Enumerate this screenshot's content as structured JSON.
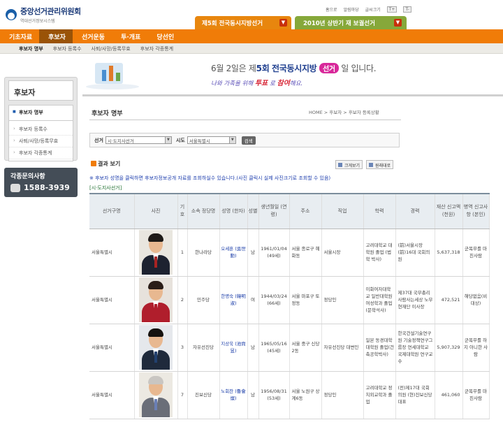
{
  "header": {
    "logo_title": "중앙선거관리위원회",
    "logo_subtitle": "역대선거정보시스템",
    "util_links": [
      "홈으로",
      "알림마당",
      "글씨크기"
    ],
    "font_up": "T+",
    "font_down": "T-"
  },
  "election_tabs": [
    {
      "label": "제5회 전국동시지방선거",
      "color": "#e8860e"
    },
    {
      "label": "2010년 상반기 재 보궐선거",
      "color": "#86a83a"
    }
  ],
  "nav": {
    "items": [
      "기초자료",
      "후보자",
      "선거운동",
      "투·개표",
      "당선인"
    ],
    "active": "후보자"
  },
  "subnav": {
    "items": [
      "후보자 명부",
      "후보자 등록수",
      "사퇴/사망/등록무효",
      "후보자 각종통계"
    ],
    "active": "후보자 명부"
  },
  "banner": {
    "line1_pre": "6월 2일은 제",
    "line1_num": "5회",
    "line1_mid": "전국동시지방",
    "line1_badge": "선거",
    "line1_post": "일 입니다.",
    "line2_pre": "나와 가족을 위해",
    "line2_red1": "투표",
    "line2_mid": "로",
    "line2_red2": "참여",
    "line2_post": "해요."
  },
  "sidebar": {
    "title": "후보자",
    "items": [
      "후보자 명부",
      "후보자 등록수",
      "사퇴/사망/등록무효",
      "후보자 각종통계"
    ],
    "active": "후보자 명부",
    "help_title": "각종문의사항",
    "help_phone": "1588-3939"
  },
  "page": {
    "title": "후보자 명부",
    "breadcrumb": "HOME > 후보자 > 후보자 등록상황"
  },
  "search": {
    "election_label": "선거",
    "election_value": "시·도지사선거",
    "sido_label": "시도",
    "sido_value": "서울특별시",
    "button": "검색"
  },
  "results": {
    "label": "결과 보기",
    "btn_photo": "크게보기",
    "btn_print": "원래대로",
    "note": "※ 후보자 성명을 클릭하면 후보자정보공개 자료를 조회하실수 있습니다.(사진 클릭시 실제 사진크기로 조회할 수 있음)",
    "subtitle": "[시·도지사선거]"
  },
  "table": {
    "headers": [
      "선거구명",
      "사진",
      "기호",
      "소속 정당명",
      "성명 (한자)",
      "성별",
      "생년월일 (연령)",
      "주소",
      "직업",
      "학력",
      "경력",
      "재산 신고액 (천원)",
      "병역 신고사항 (본인)"
    ],
    "rows": [
      {
        "district": "서울특별시",
        "photo": "candidate-photo-1",
        "number": "1",
        "party": "한나라당",
        "name": "오세훈 (吳世勳)",
        "gender": "남",
        "birth": "1961/01/04 (49세)",
        "address": "서울 종로구 혜화동",
        "job": "서울시장",
        "edu": "고려대학교 대학원 졸업 (법학 박사)",
        "career": "(前)서울시장 (前)16대 국회의원",
        "assets": "5,637,318",
        "military": "군복무를 마친사람"
      },
      {
        "district": "서울특별시",
        "photo": "candidate-photo-2",
        "number": "2",
        "party": "민주당",
        "name": "한명숙 (韓明淑)",
        "gender": "여",
        "birth": "1944/03/24 (66세)",
        "address": "서울 마포구 토정동",
        "job": "정당인",
        "edu": "이화여자대학교 일반대학원 여성학과 졸업(문학석사)",
        "career": "제37대 국무총리 사람사는세상 노무현재단 이사장",
        "assets": "472,521",
        "military": "해당없음(비대상)"
      },
      {
        "district": "서울특별시",
        "photo": "candidate-photo-3",
        "number": "3",
        "party": "자유선진당",
        "name": "지상욱 (池尙昱)",
        "gender": "남",
        "birth": "1965/05/16 (45세)",
        "address": "서울 중구 신당2동",
        "job": "자유선진당 대변인",
        "edu": "일본 동경대학대학원 졸업(건축공학박사)",
        "career": "한국건설기술연구원 기술정책연구그룹장 연세대학교 국제대학원 연구교수",
        "assets": "5,907,329",
        "military": "군복무를 하지 아니한 사람"
      },
      {
        "district": "서울특별시",
        "photo": "candidate-photo-4",
        "number": "7",
        "party": "진보신당",
        "name": "노회찬 (魯會燦)",
        "gender": "남",
        "birth": "1956/08/31 (53세)",
        "address": "서울 노원구 상계6동",
        "job": "정당인",
        "edu": "고려대학교 정치외교학과 졸업",
        "career": "(전)제17대 국회의원 (현)진보신당 대표",
        "assets": "461,060",
        "military": "군복무를 마친사람"
      }
    ]
  }
}
